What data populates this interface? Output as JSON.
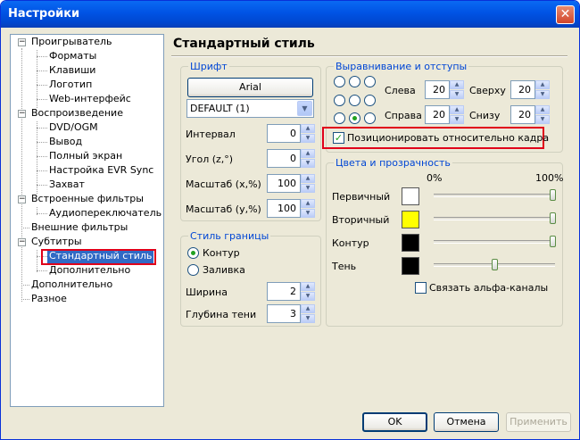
{
  "window": {
    "title": "Настройки",
    "close_glyph": "✕"
  },
  "tree": {
    "expand_glyph": "−",
    "items": [
      {
        "label": "Проигрыватель"
      },
      {
        "label": "Форматы"
      },
      {
        "label": "Клавиши"
      },
      {
        "label": "Логотип"
      },
      {
        "label": "Web-интерфейс"
      },
      {
        "label": "Воспроизведение"
      },
      {
        "label": "DVD/OGM"
      },
      {
        "label": "Вывод"
      },
      {
        "label": "Полный экран"
      },
      {
        "label": "Настройка EVR Sync"
      },
      {
        "label": "Захват"
      },
      {
        "label": "Встроенные фильтры"
      },
      {
        "label": "Аудиопереключатель"
      },
      {
        "label": "Внешние фильтры"
      },
      {
        "label": "Субтитры"
      },
      {
        "label": "Стандартный стиль",
        "selected": true
      },
      {
        "label": "Дополнительно"
      },
      {
        "label": "Дополнительно"
      },
      {
        "label": "Разное"
      }
    ]
  },
  "panel": {
    "title": "Стандартный стиль"
  },
  "font_group": {
    "title": "Шрифт",
    "font_button": "Arial",
    "charset": "DEFAULT (1)",
    "interval_label": "Интервал",
    "interval_value": "0",
    "angle_label": "Угол (z,°)",
    "angle_value": "0",
    "scale_x_label": "Масштаб (x,%)",
    "scale_x_value": "100",
    "scale_y_label": "Масштаб (y,%)",
    "scale_y_value": "100"
  },
  "border_group": {
    "title": "Стиль границы",
    "outline_label": "Контур",
    "fill_label": "Заливка",
    "selected": "outline",
    "width_label": "Ширина",
    "width_value": "2",
    "shadow_label": "Глубина тени",
    "shadow_value": "3"
  },
  "align_group": {
    "title": "Выравнивание и отступы",
    "selected_anchor": "bottom-center",
    "left_label": "Слева",
    "left_value": "20",
    "top_label": "Сверху",
    "top_value": "20",
    "right_label": "Справа",
    "right_value": "20",
    "bottom_label": "Снизу",
    "bottom_value": "20",
    "position_relative_label": "Позиционировать относительно кадра",
    "position_relative_checked": true
  },
  "colors_group": {
    "title": "Цвета и прозрачность",
    "min_label": "0%",
    "max_label": "100%",
    "rows": [
      {
        "label": "Первичный",
        "color": "#ffffff",
        "alpha_percent": 100
      },
      {
        "label": "Вторичный",
        "color": "#ffff00",
        "alpha_percent": 100
      },
      {
        "label": "Контур",
        "color": "#000000",
        "alpha_percent": 100
      },
      {
        "label": "Тень",
        "color": "#000000",
        "alpha_percent": 50
      }
    ],
    "link_alpha_label": "Связать альфа-каналы",
    "link_alpha_checked": false
  },
  "footer": {
    "ok": "OK",
    "cancel": "Отмена",
    "apply": "Применить"
  }
}
